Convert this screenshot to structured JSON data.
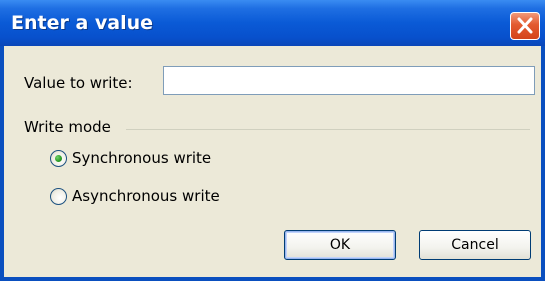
{
  "dialog": {
    "title": "Enter a value",
    "close_symbol": "×"
  },
  "value_field": {
    "label": "Value to write:",
    "value": "",
    "placeholder": ""
  },
  "write_mode": {
    "group_label": "Write mode",
    "options": [
      {
        "label": "Synchronous write",
        "selected": true
      },
      {
        "label": "Asynchronous write",
        "selected": false
      }
    ]
  },
  "buttons": {
    "ok_label": "OK",
    "cancel_label": "Cancel"
  },
  "colors": {
    "titlebar": "#0a5ad6",
    "close_button": "#e35a2f",
    "client_background": "#ece9d8",
    "radio_dot": "#2a9b25"
  },
  "icons": {
    "close": "close-icon",
    "radio_selected": "radio-selected-icon",
    "radio_unselected": "radio-unselected-icon"
  }
}
